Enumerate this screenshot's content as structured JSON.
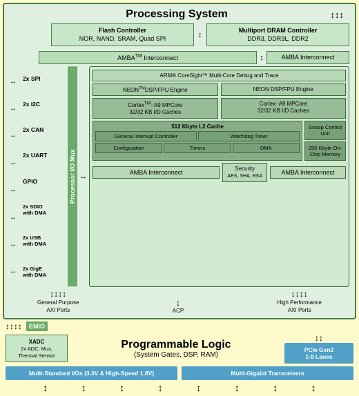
{
  "title": "Processing System",
  "controllers": {
    "flash": {
      "title": "Flash Controller",
      "subtitle": "NOR, NAND, SRAM, Quad SPI"
    },
    "dram": {
      "title": "Multiport DRAM Controller",
      "subtitle": "DDR3, DDR3L, DDR2"
    }
  },
  "amba": {
    "interconnect": "AMBA",
    "tm": "TM",
    "label": " Interconnect",
    "right_label": "AMBA Interconnect"
  },
  "io_mux": {
    "label": "Processor I/O Mux",
    "peripherals": [
      "2x SPI",
      "2x I2C",
      "2x CAN",
      "2x UART",
      "GPIO",
      "2x SDIO with DMA",
      "2x USB with DMA",
      "2x GigE with DMA"
    ]
  },
  "coresight": {
    "title": "ARM® CoreSight™ Multi-Core Debug and Trace"
  },
  "neon": {
    "left": "NEON™DSP/FPU Engine",
    "right": "NEON DSP/FPU Engine"
  },
  "cortex": {
    "left": "Cortex™- A9 MPCore\n32/32 KB I/D Caches",
    "right": "Cortex- A9 MPCore\n32/32 KB I/D Caches"
  },
  "l2_cache": {
    "title": "512 Kbyte L2 Cache",
    "general_interrupt": "General Interrupt Controller",
    "watchdog": "Watchdog Timer",
    "configuration": "Configuration",
    "timers": "Timers",
    "dma": "DMA",
    "snoop": "Snoop Control Unit",
    "onchip": "256 Kbyte On-Chip Memory"
  },
  "bottom_amba": {
    "left": "AMBA Interconnect",
    "right": "AMBA Interconnect"
  },
  "security": {
    "label": "Security",
    "subtitle": "AES, SHA, RSA"
  },
  "ports": {
    "general_purpose_axi": "General Purpose\nAXI Ports",
    "acp": "ACP",
    "high_performance_axi": "High Performance\nAXI Ports"
  },
  "emio": "EMIO",
  "prog_logic": {
    "title": "Programmable Logic",
    "subtitle": "(System Gates, DSP, RAM)"
  },
  "io_standards": {
    "left": "Multi-Standard I/Os (3.3V & High-Speed 1.8V)",
    "right": "Multi-Gigabit Transceivers"
  },
  "xadc": {
    "title": "XADC",
    "subtitle": "2x ADC, Mux,\nThermal Sensor"
  },
  "pcie": {
    "title": "PCIe Gen2\n1-8 Lanes"
  }
}
